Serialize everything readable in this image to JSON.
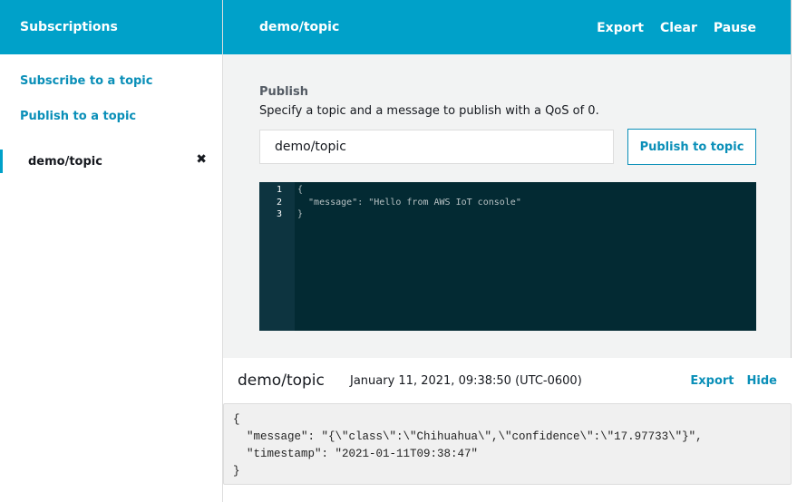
{
  "sidebar": {
    "title": "Subscriptions",
    "subscribe_link": "Subscribe to a topic",
    "publish_link": "Publish to a topic",
    "subscriptions": [
      {
        "topic": "demo/topic",
        "close_icon": "✖"
      }
    ]
  },
  "header": {
    "topic": "demo/topic",
    "export": "Export",
    "clear": "Clear",
    "pause": "Pause"
  },
  "publish": {
    "label": "Publish",
    "description": "Specify a topic and a message to publish with a QoS of 0.",
    "topic_value": "demo/topic",
    "button": "Publish to topic",
    "editor": {
      "line_numbers": "1\n2\n3",
      "code": "{\n  \"message\": \"Hello from AWS IoT console\"\n}"
    }
  },
  "message": {
    "topic": "demo/topic",
    "timestamp": "January 11, 2021, 09:38:50 (UTC-0600)",
    "export": "Export",
    "hide": "Hide",
    "payload": "{\n  \"message\": \"{\\\"class\\\":\\\"Chihuahua\\\",\\\"confidence\\\":\\\"17.97733\\\"}\",\n  \"timestamp\": \"2021-01-11T09:38:47\"\n}"
  }
}
